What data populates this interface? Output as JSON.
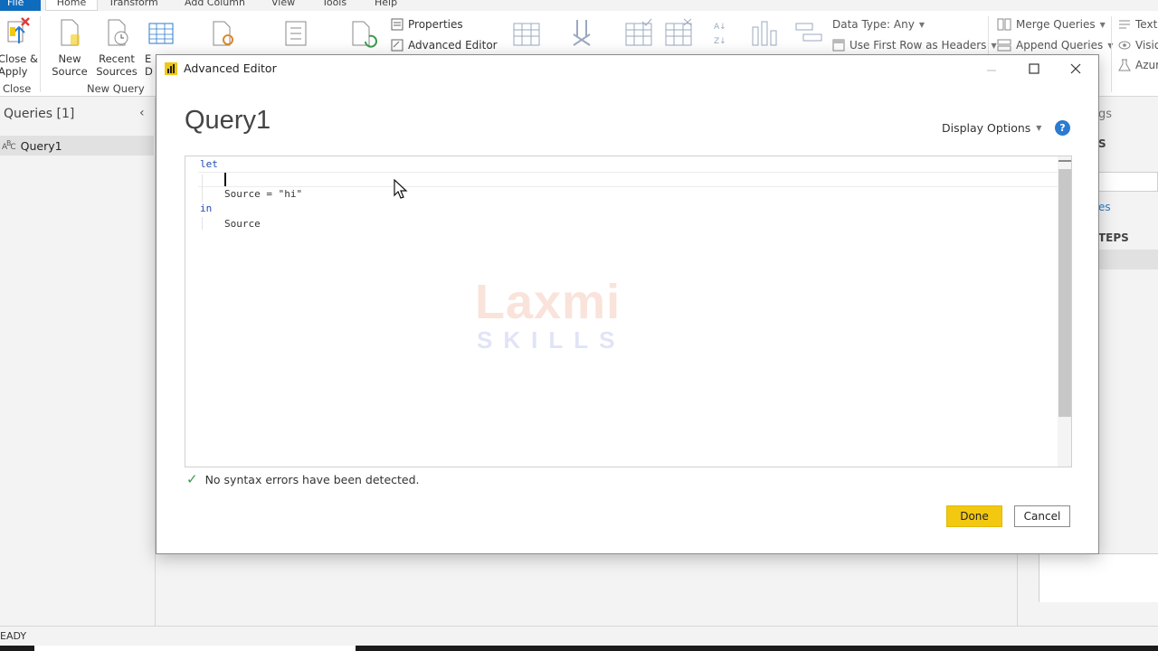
{
  "tabs": [
    "File",
    "Home",
    "Transform",
    "Add Column",
    "View",
    "Tools",
    "Help"
  ],
  "ribbon": {
    "close_apply": "Close &\nApply",
    "close_group": "Close",
    "new_source": "New\nSource",
    "recent_sources": "Recent\nSources",
    "enter_data_fragment": "E\nD",
    "new_query_group": "New Query",
    "properties": "Properties",
    "advanced_editor": "Advanced Editor",
    "data_type": "Data Type: Any",
    "use_first_row": "Use First Row as Headers",
    "merge_queries": "Merge Queries",
    "append_queries": "Append Queries",
    "text_fragment": "Text A",
    "vision_fragment": "Visio",
    "azure_fragment": "Azur"
  },
  "queries_pane": {
    "title": "Queries [1]",
    "items": [
      {
        "label": "Query1",
        "icon": "abc-123-icon"
      }
    ]
  },
  "settings_pane": {
    "frag_gs": "gs",
    "frag_s": "S",
    "frag_es": "es",
    "frag_steps": "TEPS"
  },
  "dialog": {
    "title": "Advanced Editor",
    "query_name": "Query1",
    "display_options": "Display Options",
    "help": "?",
    "code": {
      "line1_kw": "let",
      "line2": "Source = \"hi\"",
      "line3_kw": "in",
      "line4": "Source"
    },
    "watermark": {
      "main": "Laxmi",
      "sub": "SKILLS"
    },
    "status": "No syntax errors have been detected.",
    "done": "Done",
    "cancel": "Cancel"
  },
  "statusbar": {
    "text": "EADY"
  },
  "colors": {
    "accent_yellow": "#f2c811",
    "file_tab_blue": "#0f6cbd",
    "keyword_blue": "#1f4bb5",
    "success_green": "#3a9a4a"
  }
}
